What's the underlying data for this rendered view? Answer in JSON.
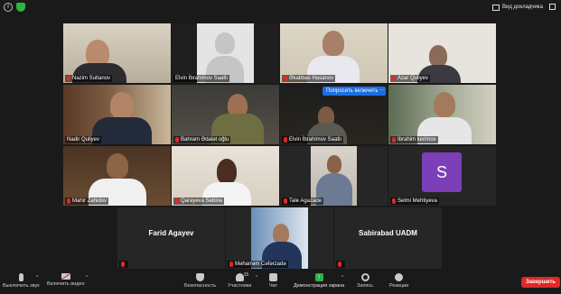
{
  "topbar": {
    "view_label": "Вид докладчика"
  },
  "participants": [
    {
      "name": "Nazim Sultanov",
      "muted": true
    },
    {
      "name": "Elvin İbrahimov Saatlı",
      "muted": false
    },
    {
      "name": "Əkabbas Hasanov",
      "muted": true
    },
    {
      "name": "Azar Quliyev",
      "muted": true
    },
    {
      "name": "Nadir Quliyev",
      "muted": false
    },
    {
      "name": "Bahram Ədalət oğlu",
      "muted": true
    },
    {
      "name": "Elvin İbrahimov Saatlı",
      "muted": true
    },
    {
      "name": "İbrahim kerimov",
      "muted": true
    },
    {
      "name": "Mahir Zahidov",
      "muted": true
    },
    {
      "name": "Qarayeva Sebine",
      "muted": true
    },
    {
      "name": "Tale Agazade",
      "muted": true
    },
    {
      "name": "Selmi Mehtiyeva",
      "muted": true,
      "avatar_letter": "S"
    },
    {
      "name": "Farid Agayev",
      "muted": true
    },
    {
      "name": "Məharrəm Cəfərzadə",
      "muted": true
    },
    {
      "name": "Sabirabad UADM",
      "muted": true
    }
  ],
  "ask_unmute_label": "Попросить включить",
  "more_label": "···",
  "toolbar": {
    "mute_label": "Выключить звук",
    "video_label": "Включить видео",
    "security_label": "Безопасность",
    "participants_label": "Участники",
    "participants_count": "15",
    "chat_label": "Чат",
    "share_label": "Демонстрация экрана",
    "record_label": "Запись",
    "reactions_label": "Реакции",
    "end_label": "Завершить"
  },
  "colors": {
    "active_speaker_border": "#9bd84a",
    "share_green": "#2fb344",
    "end_red": "#e02828",
    "ask_blue": "#1c6fe0",
    "avatar_purple": "#7b3fb8"
  }
}
